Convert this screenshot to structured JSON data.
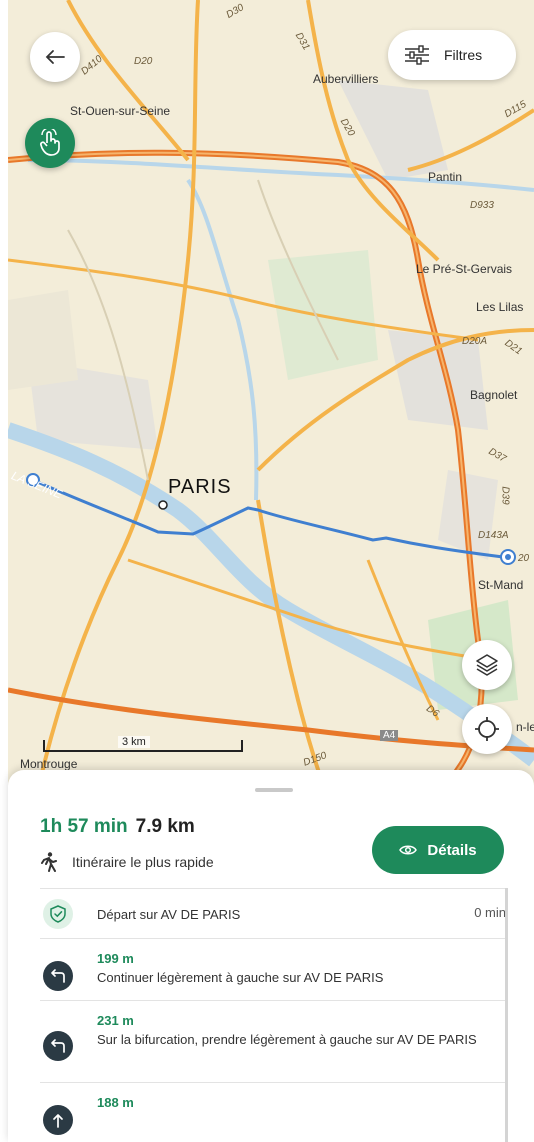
{
  "map": {
    "city_label": "PARIS",
    "river_label": "LA SEINE",
    "places": [
      "St-Ouen-sur-Seine",
      "Aubervilliers",
      "Pantin",
      "Le Pré-St-Gervais",
      "Les Lilas",
      "Bagnolet",
      "St-Mand",
      "Montrouge",
      "n-le"
    ],
    "roads": [
      "D410",
      "D20",
      "D31",
      "D20",
      "D115",
      "D933",
      "D20A",
      "D21",
      "D37",
      "D39",
      "D143A",
      "D6",
      "D150",
      "A4",
      "D30",
      "20"
    ],
    "scale_label": "3 km"
  },
  "toolbar": {
    "filters_label": "Filtres",
    "back_icon": "arrow-left-icon",
    "filters_icon": "sliders-icon",
    "gesture_icon": "hand-pointer-icon",
    "layers_icon": "layers-icon",
    "locate_icon": "crosshair-icon"
  },
  "route": {
    "duration": "1h 57 min",
    "distance": "7.9 km",
    "mode": "Itinéraire le plus rapide",
    "details_label": "Détails",
    "steps": [
      {
        "distance": "",
        "text": "Départ sur AV DE PARIS",
        "time": "0 min",
        "icon": "check-shield-icon"
      },
      {
        "distance": "199 m",
        "text": "Continuer légèrement à gauche sur AV DE PARIS",
        "time": "",
        "icon": "turn-left-icon"
      },
      {
        "distance": "231 m",
        "text": "Sur la bifurcation, prendre légèrement à gauche sur AV DE PARIS",
        "time": "",
        "icon": "turn-left-icon"
      },
      {
        "distance": "188 m",
        "text": "",
        "time": "",
        "icon": "straight-icon"
      }
    ]
  },
  "colors": {
    "accent": "#1e8a5b",
    "route_line": "#3f7fd0",
    "major_road": "#e8782a",
    "water": "#b8d6ea"
  }
}
